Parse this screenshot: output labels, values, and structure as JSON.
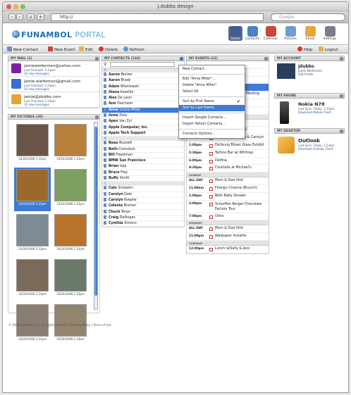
{
  "window": {
    "title": "j.dubbs design",
    "url": "http://",
    "search_placeholder": "Google"
  },
  "brand": {
    "logo_a": "FUNAMBOL",
    "logo_b": "PORTAL"
  },
  "apps": [
    {
      "label": "Home",
      "color": "#3c5e96"
    },
    {
      "label": "Contacts",
      "color": "#4a83c4"
    },
    {
      "label": "Calendar",
      "color": "#c9473c"
    },
    {
      "label": "Pictures",
      "color": "#6e9bd0"
    },
    {
      "label": "Email",
      "color": "#e3a93c"
    },
    {
      "label": "Settings",
      "color": "#7b7b8c"
    }
  ],
  "actions": {
    "new_contact": "New Contact",
    "new_event": "New Event",
    "edit": "Edit",
    "delete": "Delete",
    "refresh": "Refresh",
    "help": "Help",
    "logout": "Logout"
  },
  "mail": {
    "header": "MY MAIL (3)",
    "accounts": [
      {
        "address": "jamiewieferman@yahoo.com",
        "sync": "Last Checked: 1:23pm",
        "new": "10 new messages",
        "color": "#7a1fa3"
      },
      {
        "address": "jamie.wieferman@gmail.com",
        "sync": "Last Checked: 1:23pm",
        "new": "10 new messages",
        "color": "#3b6bd6"
      },
      {
        "address": "jamie@jdubbs.com",
        "sync": "Last Checked: 1:23pm",
        "new": "10 new messages",
        "color": "#e6a234"
      }
    ]
  },
  "pictures": {
    "header": "MY PICTURES (30)",
    "items": [
      {
        "date": "10/24/2008 1:23pm",
        "color": "#6a5548"
      },
      {
        "date": "10/24/2008 1:23pm",
        "color": "#b8803a"
      },
      {
        "date": "10/24/2008 1:23pm",
        "color": "#9b6a2b"
      },
      {
        "date": "10/24/2008 1:23pm",
        "color": "#7f9f61"
      },
      {
        "date": "10/24/2008 1:23pm",
        "color": "#7c8b95"
      },
      {
        "date": "10/24/2008 1:23pm",
        "color": "#b8722a"
      },
      {
        "date": "10/24/2008 1:23pm",
        "color": "#7a6a5a"
      },
      {
        "date": "10/24/2008 1:23pm",
        "color": "#6a7a6a"
      },
      {
        "date": "10/24/2008 1:23pm",
        "color": "#8a7d72"
      },
      {
        "date": "10/24/2008 1:23pm",
        "color": "#93846e"
      }
    ]
  },
  "contacts": {
    "header": "MY CONTACTS (134)",
    "rows": [
      {
        "sep": "A"
      },
      {
        "first": "Aaron",
        "last": "Becker"
      },
      {
        "first": "Aaron",
        "last": "Brady"
      },
      {
        "first": "Adam",
        "last": "Wisniewski"
      },
      {
        "first": "Alana",
        "last": "Kaselitz"
      },
      {
        "first": "Alex",
        "last": "De Leon"
      },
      {
        "first": "Ann",
        "last": "Deichsler"
      },
      {
        "first": "Anna",
        "last": "Louise Miller",
        "sel": true
      },
      {
        "first": "Anne",
        "last": "Doty"
      },
      {
        "first": "Apex",
        "last": "Van Zyl"
      },
      {
        "first": "Apple Computer, Inc.",
        "last": ""
      },
      {
        "first": "Apple Tech Support",
        "last": ""
      },
      {
        "sep": "B"
      },
      {
        "first": "Beau",
        "last": "Buzzelli"
      },
      {
        "first": "Beth",
        "last": "Comstock"
      },
      {
        "first": "Bill",
        "last": "Freedman"
      },
      {
        "first": "BMW San Francisco",
        "last": ""
      },
      {
        "first": "Brian",
        "last": "Upp"
      },
      {
        "first": "Bruce",
        "last": "Frey"
      },
      {
        "first": "Buffy",
        "last": "Smith"
      },
      {
        "sep": "C"
      },
      {
        "first": "Cale",
        "last": "Schwalm"
      },
      {
        "first": "Carolyn",
        "last": "Gale"
      },
      {
        "first": "Carolyn",
        "last": "Koepke"
      },
      {
        "first": "Celeste",
        "last": "Bremer"
      },
      {
        "first": "Chuck",
        "last": "Terpo"
      },
      {
        "first": "Craig",
        "last": "Dellinges"
      },
      {
        "first": "Cynthia",
        "last": "Simons"
      }
    ]
  },
  "menu": {
    "items": [
      {
        "label": "New Contact..."
      },
      {
        "sep": true
      },
      {
        "label": "Edit \"Anna Miller\"..."
      },
      {
        "label": "Delete \"Anna Miller\""
      },
      {
        "label": "Select All"
      },
      {
        "sep": true
      },
      {
        "label": "Sort by First Name",
        "check": "✔"
      },
      {
        "label": "Sort by Last Name",
        "sel": true
      },
      {
        "sep": true
      },
      {
        "label": "Import Google Contacts..."
      },
      {
        "label": "Import Yahoo! Contacts..."
      },
      {
        "sep": true
      },
      {
        "label": "Contacts Options..."
      }
    ]
  },
  "events": {
    "header": "MY EVENTS (22)",
    "peek": "bol AJAX",
    "peek2": "Meeting",
    "rows": [
      {
        "time": "",
        "title": ""
      },
      {
        "time": "",
        "title": ""
      },
      {
        "time": "",
        "title": ""
      },
      {
        "time": "",
        "title": "",
        "sel": true
      },
      {
        "time": "",
        "title": ""
      },
      {
        "time": "",
        "title": ""
      },
      {
        "time": "",
        "title": "Holiday Party"
      },
      {
        "day": "SATURDAY"
      },
      {
        "time": "ALL DAY",
        "title": "Mom & Dad Visit"
      },
      {
        "time": "9:30am",
        "title": "United Flight #152"
      },
      {
        "time": "11:30am",
        "title": "Brunch with Bruce & Carolyn"
      },
      {
        "time": "2:00pm",
        "title": "DeYoung Blown Glass Exhibit"
      },
      {
        "time": "5:30pm",
        "title": "Tartine Bar w/ Whitney"
      },
      {
        "time": "6:00pm",
        "title": "Delfina"
      },
      {
        "time": "9:30pm",
        "title": "Cocktails at Michael's"
      },
      {
        "day": "SUNDAY"
      },
      {
        "time": "ALL DAY",
        "title": "Mom & Dad Visit"
      },
      {
        "time": "11:00am",
        "title": "Foreign Cinema (Brunch)"
      },
      {
        "time": "1:00pm",
        "title": "Beth Baby Shower"
      },
      {
        "time": "3:00pm",
        "title": "Scharffen Berger Chocolate",
        "title2": "Factory Tour"
      },
      {
        "time": "7:00pm",
        "title": "Osha"
      },
      {
        "day": "MONDAY"
      },
      {
        "time": "ALL DAY",
        "title": "Mom & Dad Visit"
      },
      {
        "time": "11:00pm",
        "title": "Wallpaper Installer"
      },
      {
        "day": "TUESDAY"
      },
      {
        "time": "12:00pm",
        "title": "Lunch w/Sally & Jess"
      }
    ]
  },
  "account": {
    "header": "MY ACCOUNT",
    "name": "jdubbs",
    "full": "Jamie Wieferman",
    "link": "Edit Profile"
  },
  "phone": {
    "header": "MY PHONE",
    "model": "Nokia N78",
    "sync": "Last Sync: Today, 1:23pm",
    "link": "Download Mobile Client"
  },
  "desktop": {
    "header": "MY DESKTOP",
    "app": "Outlook",
    "sync": "Last Sync: Today, 1:23pm",
    "link": "Download Outlook Client"
  },
  "footer": {
    "text": "© 2008 Funambol, Inc. All rights reserved.  |  Privacy Policy  |  Terms of Use"
  }
}
